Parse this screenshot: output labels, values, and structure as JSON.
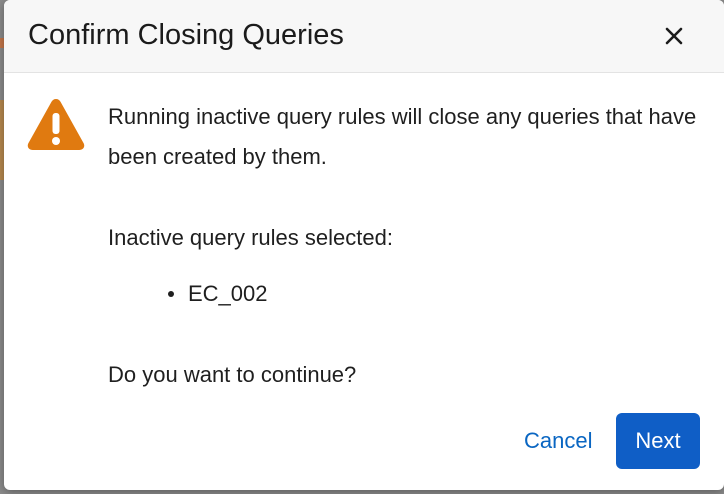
{
  "dialog": {
    "title": "Confirm Closing Queries",
    "close_icon": "close-icon",
    "warning_icon": "warning-triangle-icon",
    "message": "Running inactive query rules will close any queries that have been created by them.",
    "selected_label": "Inactive query rules selected:",
    "selected_rules": [
      "EC_002"
    ],
    "prompt": "Do you want to continue?",
    "cancel_label": "Cancel",
    "next_label": "Next"
  },
  "colors": {
    "primary_button": "#0f5ec6",
    "link": "#0a66c2",
    "warning": "#e07a10"
  }
}
